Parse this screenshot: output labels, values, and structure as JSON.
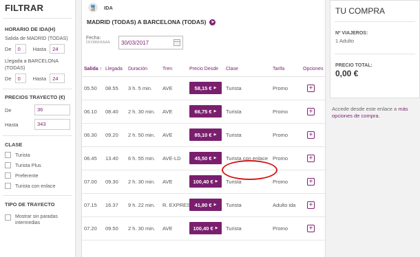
{
  "sidebar": {
    "title": "FILTRAR",
    "horario": {
      "heading": "HORARIO DE IDA(H)",
      "salida_label": "Salida de MADRID (TODAS)",
      "salida_de": "De",
      "salida_from": "0",
      "salida_hasta": "Hasta",
      "salida_to": "24",
      "llegada_label": "Llegada a BARCELONA (TODAS)",
      "llegada_de": "De",
      "llegada_from": "0",
      "llegada_hasta": "Hasta",
      "llegada_to": "24"
    },
    "precios": {
      "heading": "PRECIOS TRAYECTO (€)",
      "de_label": "De",
      "de_value": "36",
      "hasta_label": "Hasta",
      "hasta_value": "343"
    },
    "clase": {
      "heading": "CLASE",
      "options": [
        "Turista",
        "Turista Plus",
        "Preferente",
        "Turista con enlace"
      ]
    },
    "tipo": {
      "heading": "TIPO DE TRAYECTO",
      "option": "Mostrar sin paradas intermedias"
    }
  },
  "main": {
    "direction": "IDA",
    "route": "MADRID (TODAS) A BARCELONA (TODAS)",
    "fecha_label": "Fecha:",
    "fecha_format": "DD/MM/AAAA",
    "fecha_value": "30/03/2017",
    "columns": [
      "Salida",
      "Llegada",
      "Duración",
      "Tren",
      "Precio Desde",
      "Clase",
      "Tarifa",
      "Opciones"
    ],
    "sort_indicator": "↑",
    "rows": [
      {
        "salida": "05.50",
        "llegada": "08.55",
        "duracion": "3 h. 5 min.",
        "tren": "AVE",
        "precio": "58,15 €",
        "clase": "Turista",
        "tarifa": "Promo"
      },
      {
        "salida": "06.10",
        "llegada": "08.40",
        "duracion": "2 h. 30 min.",
        "tren": "AVE",
        "precio": "66,75 €",
        "clase": "Turista",
        "tarifa": "Promo"
      },
      {
        "salida": "06.30",
        "llegada": "09.20",
        "duracion": "2 h. 50 min.",
        "tren": "AVE",
        "precio": "85,10 €",
        "clase": "Turista",
        "tarifa": "Promo"
      },
      {
        "salida": "06.45",
        "llegada": "13.40",
        "duracion": "6 h. 55 min.",
        "tren": "AVE-LD",
        "precio": "45,50 €",
        "clase": "Turista con enlace",
        "tarifa": "Promo"
      },
      {
        "salida": "07.00",
        "llegada": "09.30",
        "duracion": "2 h. 30 min.",
        "tren": "AVE",
        "precio": "100,40 €",
        "clase": "Turista",
        "tarifa": "Promo"
      },
      {
        "salida": "07.15",
        "llegada": "16.37",
        "duracion": "9 h. 22 min.",
        "tren": "R. EXPRES",
        "precio": "41,80 €",
        "clase": "Turista",
        "tarifa": "Adulto ida"
      },
      {
        "salida": "07.20",
        "llegada": "09.50",
        "duracion": "2 h. 30 min.",
        "tren": "AVE",
        "precio": "100,40 €",
        "clase": "Turista",
        "tarifa": "Promo"
      }
    ],
    "option_symbol": "+"
  },
  "cart": {
    "title": "TU COMPRA",
    "viajeros_label": "Nº VIAJEROS:",
    "viajeros_value": "1 Adulto",
    "total_label": "PRECIO TOTAL:",
    "total_value": "0,00 €",
    "access_text": "Accede desde este enlace a",
    "access_link": "más opciones de compra."
  },
  "colors": {
    "accent": "#7a1f6e",
    "annotation": "#d41a1a"
  },
  "icons": {
    "train": "train-icon",
    "route_arrow": "arrow-right-icon",
    "calendar": "calendar-icon",
    "add": "plus-icon"
  }
}
